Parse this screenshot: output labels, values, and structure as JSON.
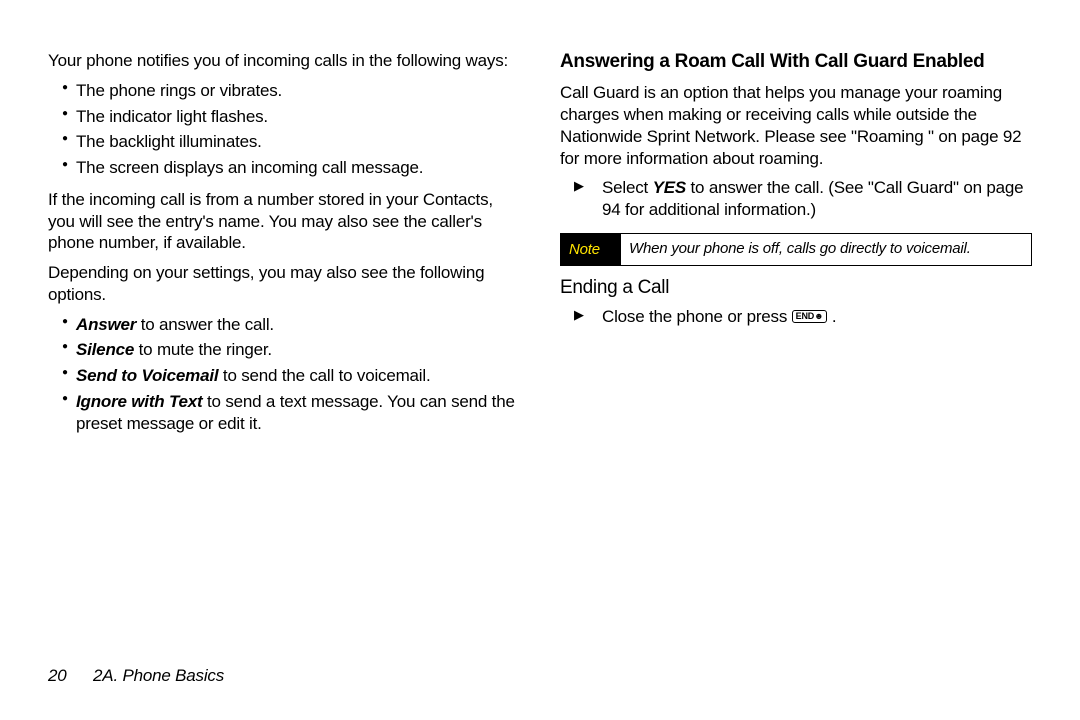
{
  "left": {
    "intro": "Your phone notifies you of incoming calls in the following ways:",
    "notify": [
      "The phone rings or vibrates.",
      "The indicator light flashes.",
      "The backlight illuminates.",
      "The screen displays an incoming call message."
    ],
    "contacts": "If the incoming call is from a number stored in your Contacts, you will see the entry's name. You may also see the caller's phone number, if available.",
    "depending": "Depending on your settings, you may also see the following options.",
    "opts": {
      "answer_b": "Answer",
      "answer_t": " to answer the call.",
      "silence_b": "Silence",
      "silence_t": " to mute the ringer.",
      "voicemail_b": "Send to Voicemail",
      "voicemail_t": " to send the call to voicemail.",
      "ignore_b": "Ignore with Text",
      "ignore_t": " to send a text message. You can send the preset message or edit it."
    }
  },
  "right": {
    "h_roam": "Answering a Roam Call With Call Guard Enabled",
    "roam_body": "Call Guard is an option that helps you manage your roaming charges when making or receiving calls while outside the Nationwide Sprint Network. Please see \"Roaming \" on page 92 for more information about roaming.",
    "select_pre": "Select ",
    "select_yes": "YES",
    "select_post": " to answer the call. (See \"Call Guard\" on page 94 for additional information.)",
    "note_label": "Note",
    "note_text": "When your phone is off, calls go directly to voicemail.",
    "h_end": "Ending a Call",
    "end_text": "Close the phone or press ",
    "end_key": "END☻",
    "end_tail": " ."
  },
  "footer": {
    "page": "20",
    "section": "2A. Phone Basics"
  }
}
